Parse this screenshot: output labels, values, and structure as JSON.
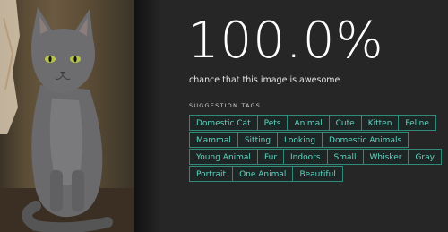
{
  "photo": {
    "icon": "cat-photo"
  },
  "result": {
    "score": "100.0%",
    "caption": "chance that this image is awesome"
  },
  "suggestions": {
    "label": "SUGGESTION TAGS",
    "tags": [
      "Domestic Cat",
      "Pets",
      "Animal",
      "Cute",
      "Kitten",
      "Feline",
      "Mammal",
      "Sitting",
      "Looking",
      "Domestic Animals",
      "Young Animal",
      "Fur",
      "Indoors",
      "Small",
      "Whisker",
      "Gray",
      "Portrait",
      "One Animal",
      "Beautiful"
    ]
  },
  "colors": {
    "background": "#262626",
    "tag_text": "#5fd4c1",
    "tag_border": "#2f8a7c"
  }
}
